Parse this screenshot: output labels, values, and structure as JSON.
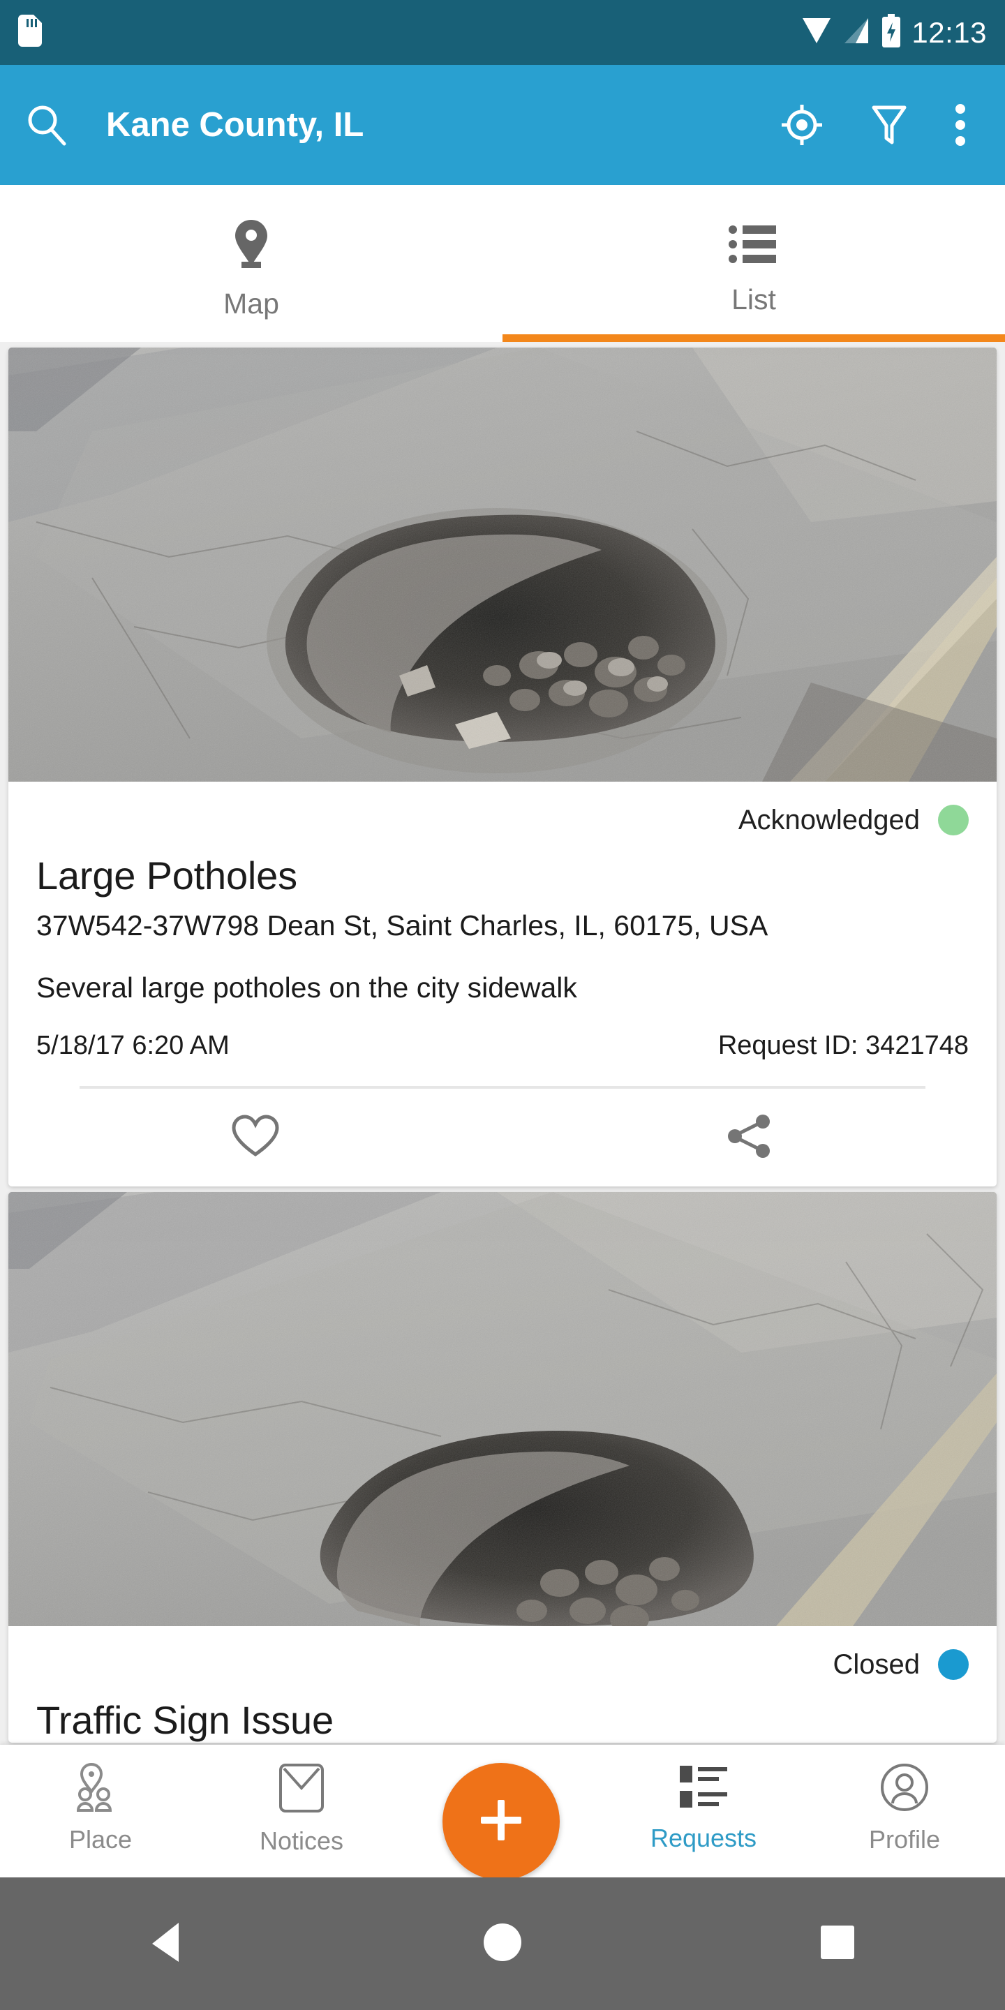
{
  "status_bar": {
    "time": "12:13",
    "icons": [
      "sd-card-icon",
      "wifi-icon",
      "cellular-signal-icon",
      "battery-charging-icon"
    ]
  },
  "app_bar": {
    "title": "Kane County, IL",
    "search_icon": "search-icon",
    "locate_icon": "my-location-icon",
    "filter_icon": "filter-funnel-icon",
    "overflow_icon": "more-vertical-icon",
    "background_color": "#29a0d0"
  },
  "tabs": [
    {
      "label": "Map",
      "icon": "map-pin-icon",
      "active": false
    },
    {
      "label": "List",
      "icon": "list-bullet-icon",
      "active": true
    }
  ],
  "tab_indicator_color": "#f3871b",
  "requests": [
    {
      "status": "Acknowledged",
      "status_color": "#8fd898",
      "title": "Large Potholes",
      "address": "37W542-37W798 Dean St, Saint Charles, IL, 60175, USA",
      "description": "Several large potholes on the city sidewalk",
      "timestamp": "5/18/17 6:20 AM",
      "request_id": "Request ID: 3421748",
      "favorite_icon": "heart-outline-icon",
      "share_icon": "share-icon",
      "photo": "pothole-photo"
    },
    {
      "status": "Closed",
      "status_color": "#1a9ad0",
      "title": "Traffic Sign Issue",
      "photo": "pothole-photo-2"
    }
  ],
  "bottom_nav": {
    "items": [
      {
        "label": "Place",
        "icon": "place-people-icon",
        "active": false
      },
      {
        "label": "Notices",
        "icon": "envelope-icon",
        "active": false
      },
      {
        "label": "Requests",
        "icon": "requests-list-icon",
        "active": true
      },
      {
        "label": "Profile",
        "icon": "person-circle-icon",
        "active": false
      }
    ],
    "fab": {
      "icon": "plus-icon",
      "color": "#ef7218"
    },
    "active_color": "#2e9bc6"
  },
  "android_nav": {
    "back": "back-triangle-icon",
    "home": "home-circle-icon",
    "recents": "recents-square-icon"
  }
}
